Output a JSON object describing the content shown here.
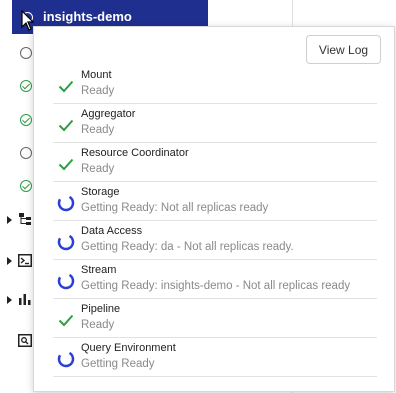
{
  "sidebar": {
    "active_item": "insights-demo"
  },
  "popup": {
    "view_log_label": "View Log",
    "items": [
      {
        "name": "Mount",
        "status": "Ready",
        "state": "ready"
      },
      {
        "name": "Aggregator",
        "status": "Ready",
        "state": "ready"
      },
      {
        "name": "Resource Coordinator",
        "status": "Ready",
        "state": "ready"
      },
      {
        "name": "Storage",
        "status": "Getting Ready: Not all replicas ready",
        "state": "pending"
      },
      {
        "name": "Data Access",
        "status": "Getting Ready: da - Not all replicas ready.",
        "state": "pending"
      },
      {
        "name": "Stream",
        "status": "Getting Ready: insights-demo - Not all replicas ready",
        "state": "pending"
      },
      {
        "name": "Pipeline",
        "status": "Ready",
        "state": "ready"
      },
      {
        "name": "Query Environment",
        "status": "Getting Ready",
        "state": "pending"
      }
    ]
  },
  "colors": {
    "active_bg": "#1f2f8f",
    "ready": "#2e9e44",
    "pending": "#2a3fd6"
  }
}
